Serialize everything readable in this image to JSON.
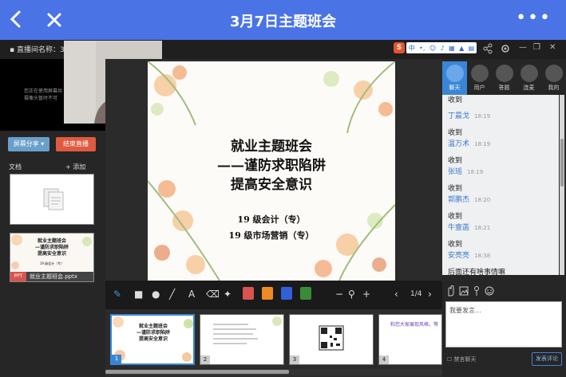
{
  "header": {
    "title": "3月7日主题班会"
  },
  "window": {
    "room_name": "直播间名称：3月"
  },
  "left": {
    "video_msg_line1": "您正在使用屏幕共",
    "video_msg_line2": "摄像头暂时不可",
    "screen_share_label": "屏幕分享 ▾",
    "end_live_label": "结束直播",
    "docs_label": "文档",
    "add_label": "+ 添加",
    "doc_thumb_title1": "就业主题班会",
    "doc_thumb_title2": "—谨防求职陷阱",
    "doc_thumb_title3": "提高安全意识",
    "doc_thumb_sub": "19 级会计（专）",
    "doc_type": "PPT",
    "doc_filename": "就业主题班会.pptx"
  },
  "slide": {
    "title1": "就业主题班会",
    "title2": "——谨防求职陷阱",
    "title3": "提高安全意识",
    "class1": "19 级会计（专）",
    "class2": "19 级市场营销（专）"
  },
  "tabs": [
    {
      "label": "聊天",
      "icon": "chat-icon"
    },
    {
      "label": "用户",
      "icon": "users-icon"
    },
    {
      "label": "答题",
      "icon": "pen-icon"
    },
    {
      "label": "连麦",
      "icon": "mic-icon"
    },
    {
      "label": "我的",
      "icon": "person-icon"
    }
  ],
  "chat": {
    "top_partial": "收到",
    "messages": [
      {
        "name": "丁晨戈",
        "time": "18:19",
        "text": "收到"
      },
      {
        "name": "温万术",
        "time": "18:19",
        "text": "收到"
      },
      {
        "name": "张瑶",
        "time": "18:19",
        "text": "收到"
      },
      {
        "name": "郭鹏杰",
        "time": "18:20",
        "text": "收到"
      },
      {
        "name": "牛壹菡",
        "time": "18:21",
        "text": "收到"
      },
      {
        "name": "安亮亮",
        "time": "18:38",
        "text": "后面还有啥事情嘛"
      }
    ],
    "input_placeholder": "我要发言...",
    "ban_label": "禁言聊天",
    "send_label": "发表评论"
  },
  "toolbar": {
    "page": "1/4"
  },
  "thumbs": {
    "t1_line1": "就业主题班会",
    "t1_line2": "—谨防求职陷阱",
    "t1_line3": "提高安全意识",
    "t4_text": "和您大家展现风格，等",
    "nums": [
      "1",
      "2",
      "3",
      "4"
    ]
  },
  "colors": {
    "accent": "#4a74e6",
    "red": "#d9534f",
    "orange": "#f08a24",
    "blue": "#3160d8",
    "green": "#3a8a3a"
  }
}
